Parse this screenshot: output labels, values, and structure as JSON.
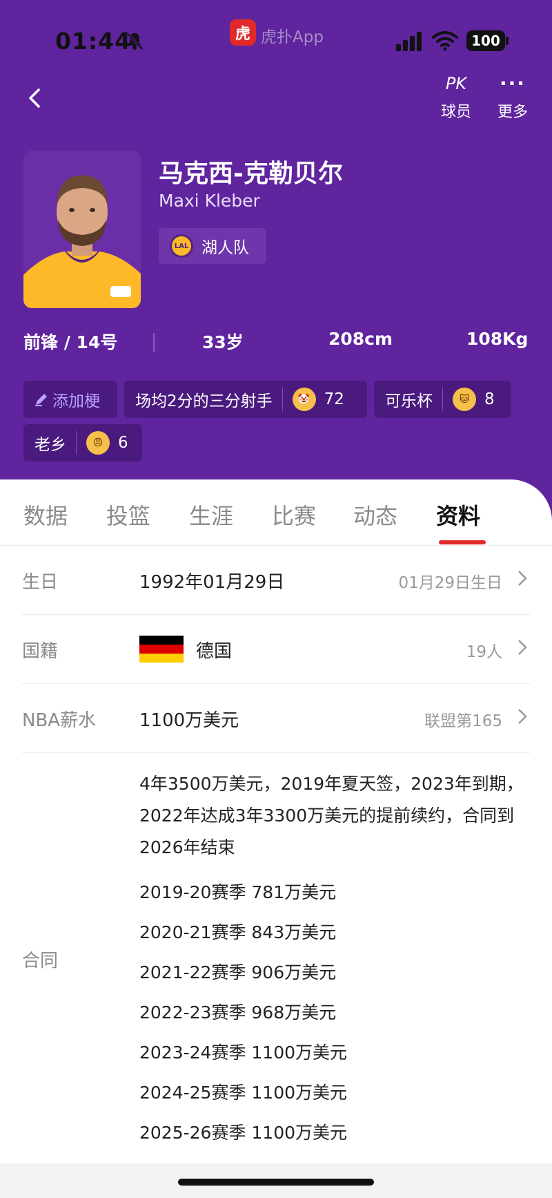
{
  "status_bar": {
    "time": "01:44",
    "app_name": "虎扑App",
    "app_icon_text": "虎",
    "battery": "100"
  },
  "nav": {
    "pk_icon": "PK",
    "pk_label": "球员",
    "more_icon": "···",
    "more_label": "更多"
  },
  "player": {
    "name_cn": "马克西-克勒贝尔",
    "name_en": "Maxi Kleber",
    "team": "湖人队",
    "team_logo_text": "LAL",
    "position": "前锋 / 14号",
    "age": "33岁",
    "height": "208cm",
    "weight": "108Kg"
  },
  "tags": {
    "add_label": "添加梗",
    "items": [
      {
        "text": "场均2分的三分射手",
        "emoji": "clown-emoji",
        "count": "72"
      },
      {
        "text": "可乐杯",
        "emoji": "cat-emoji",
        "count": "8"
      },
      {
        "text": "老乡",
        "emoji": "angry-emoji",
        "count": "6"
      }
    ]
  },
  "tabs": [
    "数据",
    "投篮",
    "生涯",
    "比赛",
    "动态",
    "资料"
  ],
  "active_tab": "资料",
  "info": {
    "birthday": {
      "label": "生日",
      "value": "1992年01月29日",
      "right": "01月29日生日"
    },
    "nationality": {
      "label": "国籍",
      "value": "德国",
      "right": "19人",
      "flag_colors": [
        "#000000",
        "#dd0000",
        "#ffce00"
      ]
    },
    "salary": {
      "label": "NBA薪水",
      "value": "1100万美元",
      "right": "联盟第165"
    },
    "contract": {
      "label": "合同",
      "note": "4年3500万美元，2019年夏天签，2023年到期，2022年达成3年3300万美元的提前续约，合同到2026年结束",
      "seasons": [
        "2019-20赛季 781万美元",
        "2020-21赛季 843万美元",
        "2021-22赛季 906万美元",
        "2022-23赛季 968万美元",
        "2023-24赛季 1100万美元",
        "2024-25赛季 1100万美元",
        "2025-26赛季 1100万美元"
      ]
    }
  },
  "colors": {
    "header_bg": "#5f249e",
    "tag_bg": "#4a1a7e",
    "accent_red": "#e02a2a"
  }
}
